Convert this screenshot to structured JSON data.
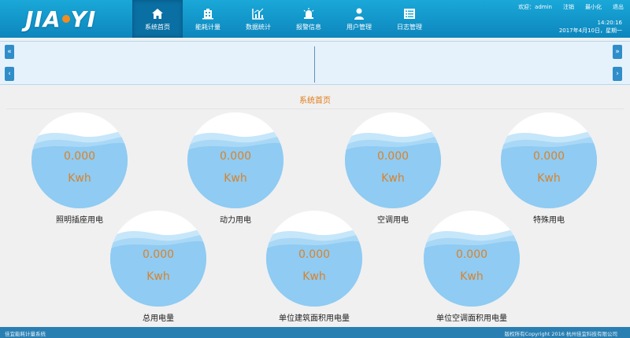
{
  "brand": {
    "logo_text_a": "JIA",
    "logo_text_b": "YI"
  },
  "nav": [
    {
      "label": "系统首页",
      "icon": "home-icon",
      "active": true
    },
    {
      "label": "能耗计量",
      "icon": "building-icon",
      "active": false
    },
    {
      "label": "数据统计",
      "icon": "chart-icon",
      "active": false
    },
    {
      "label": "报警信息",
      "icon": "alarm-icon",
      "active": false
    },
    {
      "label": "用户管理",
      "icon": "user-icon",
      "active": false
    },
    {
      "label": "日志管理",
      "icon": "list-icon",
      "active": false
    }
  ],
  "user_bar": {
    "welcome": "欢迎：admin",
    "logout": "注销",
    "minimize": "最小化",
    "exit": "退出"
  },
  "clock": {
    "time": "14:20:16",
    "date": "2017年4月10日，星期一"
  },
  "page_title": "系统首页",
  "gauges": [
    {
      "value": "0.000",
      "unit": "Kwh",
      "label": "照明插座用电"
    },
    {
      "value": "0.000",
      "unit": "Kwh",
      "label": "动力用电"
    },
    {
      "value": "0.000",
      "unit": "Kwh",
      "label": "空调用电"
    },
    {
      "value": "0.000",
      "unit": "Kwh",
      "label": "特殊用电"
    },
    {
      "value": "0.000",
      "unit": "Kwh",
      "label": "总用电量"
    },
    {
      "value": "0.000",
      "unit": "Kwh",
      "label": "单位建筑面积用电量"
    },
    {
      "value": "0.000",
      "unit": "Kwh",
      "label": "单位空调面积用电量"
    }
  ],
  "footer": {
    "left": "佳宜能耗计量系统",
    "right": "版权所有Copyright 2016 杭州佳宜科技有限公司"
  },
  "colors": {
    "header": "#1aa8d8",
    "accent": "#e07b1a",
    "water": "#8fcbf2",
    "footer": "#2a7fb2"
  }
}
